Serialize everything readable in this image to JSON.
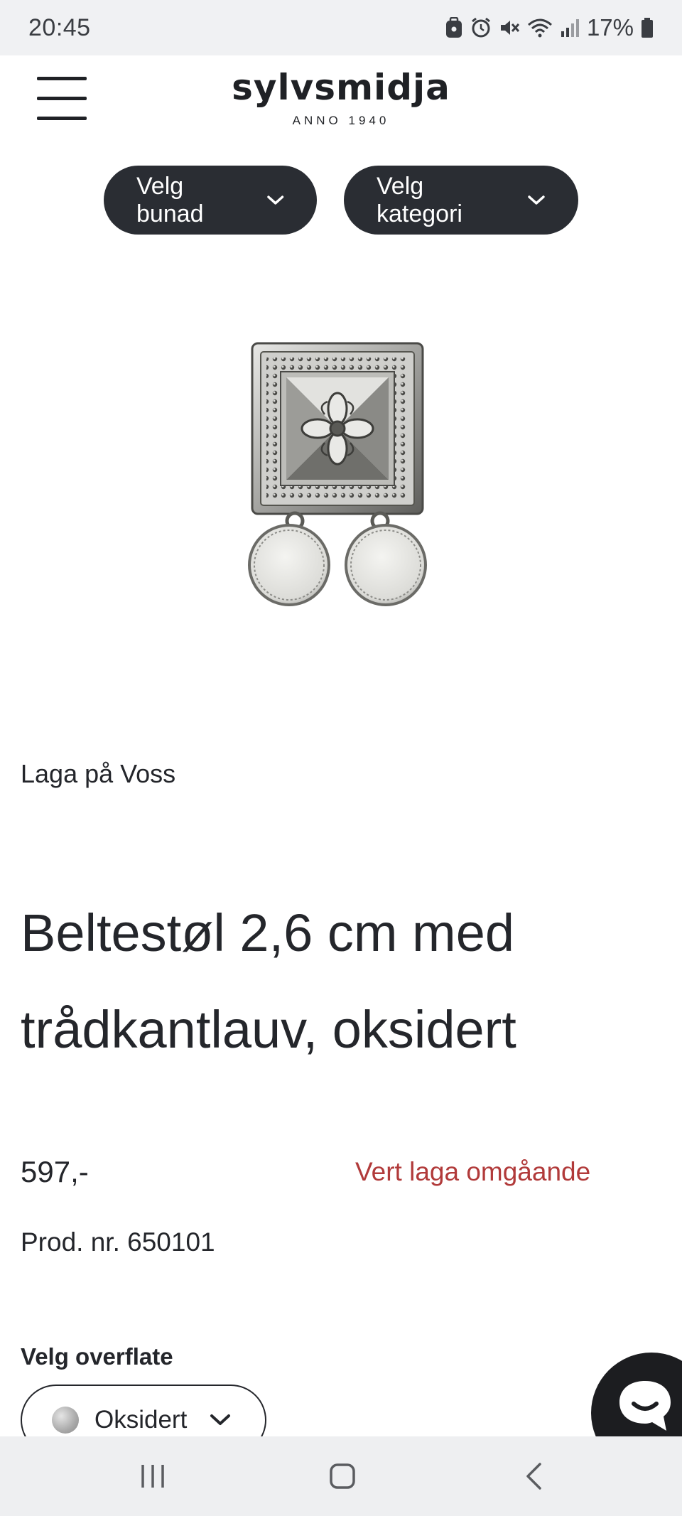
{
  "status_bar": {
    "time": "20:45",
    "battery": "17%",
    "icons": [
      "lock-icon",
      "alarm-icon",
      "mute-icon",
      "wifi-icon",
      "signal-icon",
      "battery-icon"
    ]
  },
  "header": {
    "logo_text": "sylvsmidja",
    "logo_subtitle": "ANNO 1940",
    "menu_icon": "hamburger-menu-icon"
  },
  "filters": {
    "bunad_label": "Velg bunad",
    "kategori_label": "Velg kategori"
  },
  "product": {
    "maker": "Laga på Voss",
    "title": "Beltestøl 2,6 cm med trådkantlauv, oksidert",
    "price": "597,-",
    "availability": "Vert laga omgåande",
    "product_number": "Prod. nr. 650101",
    "surface_label": "Velg overflate",
    "surface_selected": "Oksidert"
  },
  "colors": {
    "primary_dark": "#2a2d33",
    "availability_red": "#b13a3a",
    "text": "#24262b"
  },
  "nav_bar": {
    "icons": [
      "recent-apps-icon",
      "home-icon",
      "back-icon"
    ]
  }
}
